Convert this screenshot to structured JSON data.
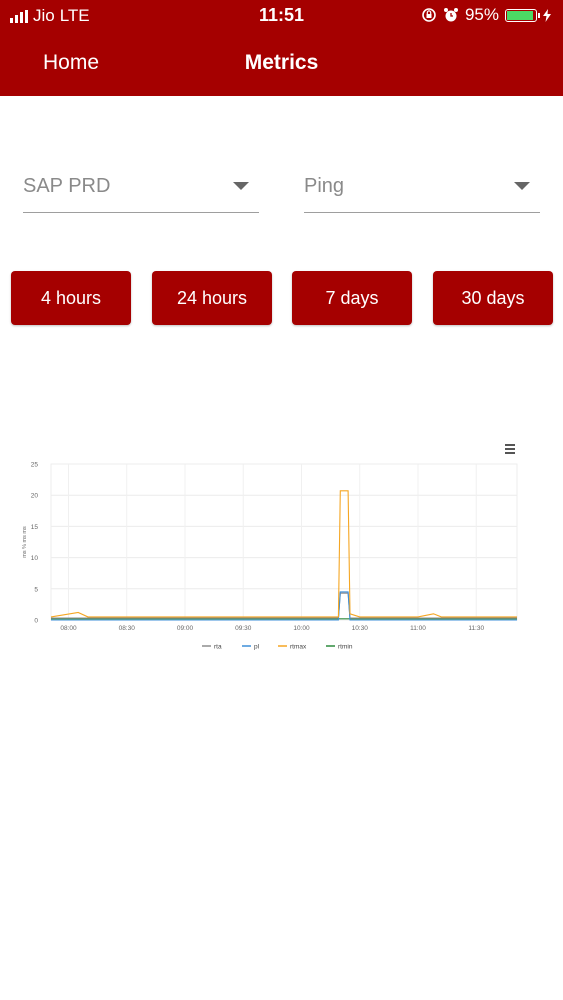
{
  "status_bar": {
    "carrier": "Jio",
    "network": "LTE",
    "time": "11:51",
    "battery_percent": "95%",
    "battery_level": 0.95
  },
  "nav": {
    "back_label": "Home",
    "title": "Metrics"
  },
  "selects": {
    "system": "SAP PRD",
    "metric": "Ping"
  },
  "ranges": [
    "4 hours",
    "24 hours",
    "7 days",
    "30 days"
  ],
  "colors": {
    "brand": "#a50000",
    "rta": "#8e8e8e",
    "pl": "#3e8fd8",
    "rtmax": "#f5a623",
    "rtmin": "#2e8b3d"
  },
  "chart_data": {
    "type": "line",
    "title": "",
    "xlabel": "",
    "ylabel": "ms % ms ms",
    "ylim": [
      0,
      25
    ],
    "y_ticks": [
      0,
      5,
      10,
      15,
      20,
      25
    ],
    "x_ticks": [
      "08:00",
      "08:30",
      "09:00",
      "09:30",
      "10:00",
      "10:30",
      "11:00",
      "11:30"
    ],
    "xlim": [
      "07:51",
      "11:51"
    ],
    "legend_position": "bottom",
    "x": [
      "07:51",
      "08:05",
      "08:10",
      "08:15",
      "08:30",
      "09:00",
      "09:30",
      "10:00",
      "10:10",
      "10:19",
      "10:20",
      "10:24",
      "10:25",
      "10:30",
      "11:00",
      "11:08",
      "11:12",
      "11:30",
      "11:51"
    ],
    "series": [
      {
        "name": "rta",
        "values": [
          0.3,
          0.3,
          0.3,
          0.3,
          0.3,
          0.3,
          0.3,
          0.3,
          0.3,
          0.3,
          4.3,
          4.3,
          0.3,
          0.3,
          0.3,
          0.3,
          0.3,
          0.3,
          0.3
        ]
      },
      {
        "name": "pl",
        "values": [
          0,
          0,
          0,
          0,
          0,
          0,
          0,
          0,
          0,
          0,
          4.5,
          4.5,
          0,
          0,
          0,
          0,
          0,
          0,
          0
        ]
      },
      {
        "name": "rtmax",
        "values": [
          0.5,
          1.2,
          0.5,
          0.5,
          0.5,
          0.5,
          0.5,
          0.5,
          0.5,
          0.5,
          20.7,
          20.7,
          1.0,
          0.5,
          0.5,
          1.0,
          0.5,
          0.5,
          0.5
        ]
      },
      {
        "name": "rtmin",
        "values": [
          0.2,
          0.2,
          0.2,
          0.2,
          0.2,
          0.2,
          0.2,
          0.2,
          0.2,
          0.2,
          0.2,
          0.2,
          0.2,
          0.2,
          0.2,
          0.2,
          0.2,
          0.2,
          0.2
        ]
      }
    ]
  }
}
